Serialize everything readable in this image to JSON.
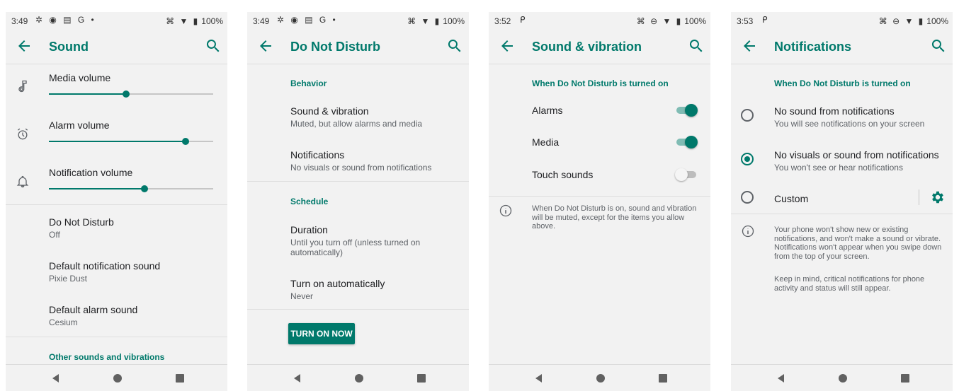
{
  "status_icons": "✲ ◉ ▤ G •",
  "status_right_glyphs_a": "⌘ ▼ ▮",
  "status_right_glyphs_b": "⌘ ⊖ ▼ ▮",
  "battery": "100%",
  "colors": {
    "accent": "#00796b",
    "background": "#f2f2f2"
  },
  "screens": [
    {
      "time": "3:49",
      "title": "Sound",
      "sliders": [
        {
          "label": "Media volume",
          "icon": "music-note-icon",
          "value": 0.47
        },
        {
          "label": "Alarm volume",
          "icon": "alarm-clock-icon",
          "value": 0.83
        },
        {
          "label": "Notification volume",
          "icon": "bell-icon",
          "value": 0.58
        }
      ],
      "items": [
        {
          "title": "Do Not Disturb",
          "sub": "Off"
        },
        {
          "title": "Default notification sound",
          "sub": "Pixie Dust"
        },
        {
          "title": "Default alarm sound",
          "sub": "Cesium"
        }
      ],
      "footer_header": "Other sounds and vibrations"
    },
    {
      "time": "3:49",
      "title": "Do Not Disturb",
      "behavior_header": "Behavior",
      "behavior_items": [
        {
          "title": "Sound & vibration",
          "sub": "Muted, but allow alarms and media"
        },
        {
          "title": "Notifications",
          "sub": "No visuals or sound from notifications"
        }
      ],
      "schedule_header": "Schedule",
      "schedule_items": [
        {
          "title": "Duration",
          "sub": "Until you turn off (unless turned on automatically)"
        },
        {
          "title": "Turn on automatically",
          "sub": "Never"
        }
      ],
      "button": "TURN ON NOW"
    },
    {
      "time": "3:52",
      "title": "Sound & vibration",
      "header": "When Do Not Disturb is turned on",
      "toggles": [
        {
          "label": "Alarms",
          "on": true
        },
        {
          "label": "Media",
          "on": true
        },
        {
          "label": "Touch sounds",
          "on": false
        }
      ],
      "info": "When Do Not Disturb is on, sound and vibration will be muted, except for the items you allow above."
    },
    {
      "time": "3:53",
      "title": "Notifications",
      "header": "When Do Not Disturb is turned on",
      "options": [
        {
          "title": "No sound from notifications",
          "sub": "You will see notifications on your screen",
          "checked": false
        },
        {
          "title": "No visuals or sound from notifications",
          "sub": "You won't see or hear notifications",
          "checked": true
        },
        {
          "title": "Custom",
          "sub": "",
          "checked": false
        }
      ],
      "info1": "Your phone won't show new or existing notifications, and won't make a sound or vibrate. Notifications won't appear when you swipe down from the top of your screen.",
      "info2": "Keep in mind, critical notifications for phone activity and status will still appear."
    }
  ]
}
